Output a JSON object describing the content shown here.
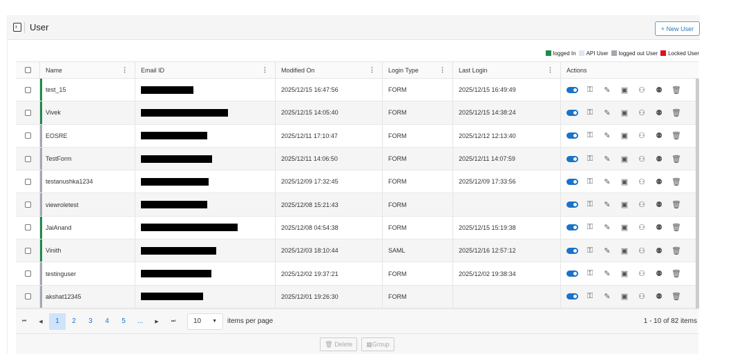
{
  "header": {
    "title": "User",
    "new_user": "+ New User"
  },
  "legend": [
    {
      "label": "logged In",
      "color": "#1e8a4c"
    },
    {
      "label": "API User",
      "color": "#dde6f3"
    },
    {
      "label": "logged out User",
      "color": "#a3a7b0"
    },
    {
      "label": "Locked User",
      "color": "#e0101e"
    }
  ],
  "columns": [
    "Name",
    "Email ID",
    "Modified On",
    "Login Type",
    "Last Login",
    "Actions"
  ],
  "rows": [
    {
      "name": "test_15",
      "modified": "2025/12/15 16:47:56",
      "type": "FORM",
      "last": "2025/12/15 16:49:49",
      "status": "#1e8a4c"
    },
    {
      "name": "Vivek",
      "modified": "2025/12/15 14:05:40",
      "type": "FORM",
      "last": "2025/12/15 14:38:24",
      "status": "#1e8a4c"
    },
    {
      "name": "EOSRE",
      "modified": "2025/12/11 17:10:47",
      "type": "FORM",
      "last": "2025/12/12 12:13:40",
      "status": "#a3a7b0"
    },
    {
      "name": "TestForm",
      "modified": "2025/12/11 14:06:50",
      "type": "FORM",
      "last": "2025/12/11 14:07:59",
      "status": "#a3a7b0"
    },
    {
      "name": "testanushka1234",
      "modified": "2025/12/09 17:32:45",
      "type": "FORM",
      "last": "2025/12/09 17:33:56",
      "status": "#a3a7b0"
    },
    {
      "name": "viewroletest",
      "modified": "2025/12/08 15:21:43",
      "type": "FORM",
      "last": "",
      "status": "#a3a7b0"
    },
    {
      "name": "JaiAnand",
      "modified": "2025/12/08 04:54:38",
      "type": "FORM",
      "last": "2025/12/15 15:19:38",
      "status": "#1e8a4c"
    },
    {
      "name": "Vinith",
      "modified": "2025/12/03 18:10:44",
      "type": "SAML",
      "last": "2025/12/16 12:57:12",
      "status": "#1e8a4c"
    },
    {
      "name": "testinguser",
      "modified": "2025/12/02 19:37:21",
      "type": "FORM",
      "last": "2025/12/02 19:38:34",
      "status": "#a3a7b0"
    },
    {
      "name": "akshat12345",
      "modified": "2025/12/01 19:26:30",
      "type": "FORM",
      "last": "",
      "status": "#a3a7b0"
    }
  ],
  "pager": {
    "pages": [
      "1",
      "2",
      "3",
      "4",
      "5",
      "..."
    ],
    "page_size": "10",
    "items_per_page": "items per page",
    "count": "1 - 10 of 82 items"
  },
  "footer": {
    "delete": "Delete",
    "group": "Group"
  }
}
